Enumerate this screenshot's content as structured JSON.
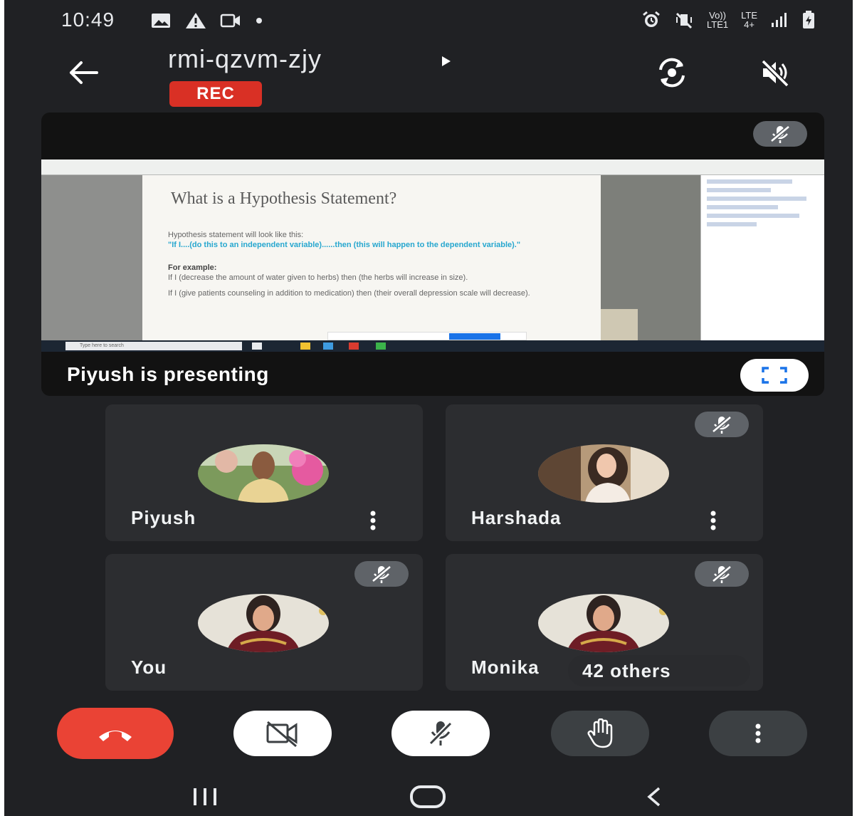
{
  "status_bar": {
    "time": "10:49",
    "net_top": "Vo))",
    "net_bottom": "LTE1",
    "lte_top": "LTE",
    "lte_bottom": "4+"
  },
  "header": {
    "meeting_code": "rmi-qzvm-zjy",
    "rec_label": "REC"
  },
  "presentation": {
    "slide_title": "What is a Hypothesis Statement?",
    "bullets": [
      "Hypothesis statement will look like this:",
      "\"If I....(do this to an independent variable)......then (this will happen to the dependent variable).\"",
      "For example:",
      "If I (decrease the amount of water given to herbs) then (the herbs will increase in size).",
      "If I (give patients counseling in addition to medication) then (their overall depression scale will decrease)."
    ],
    "taskbar_search_placeholder": "Type here to search",
    "presenting_label": "Piyush is presenting"
  },
  "participants": [
    {
      "name": "Piyush",
      "muted": false
    },
    {
      "name": "Harshada",
      "muted": true
    },
    {
      "name": "You",
      "muted": true
    },
    {
      "name": "Monika",
      "muted": true
    }
  ],
  "others_chip": "42 others",
  "controls": {
    "end_call_icon": "hang-up-icon",
    "camera_icon": "camera-off-icon",
    "mic_icon": "mic-off-icon",
    "hand_icon": "raise-hand-icon",
    "more_icon": "more-vert-icon"
  },
  "colors": {
    "background": "#202124",
    "tile": "#2c2d30",
    "end_call": "#ea4335",
    "rec": "#d93025",
    "link_blue": "#27a7cf"
  }
}
